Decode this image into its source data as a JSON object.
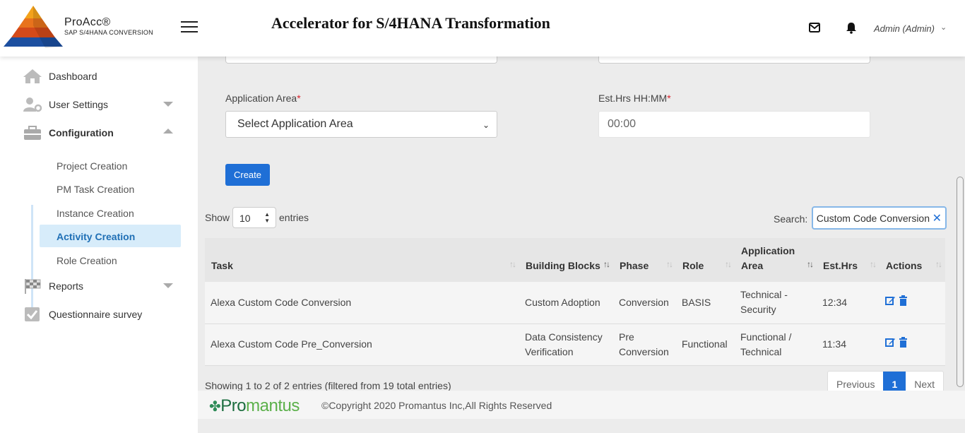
{
  "brand": {
    "title": "ProAcc®",
    "subtitle": "SAP S/4HANA CONVERSION"
  },
  "app_title": "Accelerator for S/4HANA Transformation",
  "user": {
    "name": "Admin (Admin)"
  },
  "sidebar": {
    "items": [
      {
        "label": "Dashboard",
        "icon": "home-icon"
      },
      {
        "label": "User Settings",
        "icon": "user-settings-icon"
      },
      {
        "label": "Configuration",
        "icon": "briefcase-icon"
      },
      {
        "label": "Reports",
        "icon": "flag-icon"
      },
      {
        "label": "Questionnaire survey",
        "icon": "checkbox-icon"
      }
    ],
    "config_sub": [
      {
        "label": "Project Creation"
      },
      {
        "label": "PM Task Creation"
      },
      {
        "label": "Instance Creation"
      },
      {
        "label": "Activity Creation"
      },
      {
        "label": "Role Creation"
      }
    ]
  },
  "form": {
    "app_area_label": "Application Area",
    "app_area_value": "Select Application Area",
    "est_hrs_label": "Est.Hrs HH:MM",
    "est_hrs_value": "00:00",
    "required_mark": "*",
    "create_label": "Create"
  },
  "table_controls": {
    "show_label": "Show",
    "page_length": "10",
    "entries_label": "entries",
    "search_label": "Search:",
    "search_value": "Custom Code Conversion"
  },
  "table": {
    "columns": [
      "Task",
      "Building Blocks",
      "Phase",
      "Role",
      "Application Area",
      "Est.Hrs",
      "Actions"
    ],
    "rows": [
      {
        "task": "Alexa Custom Code Conversion",
        "building_blocks": "Custom Adoption",
        "phase": "Conversion",
        "role": "BASIS",
        "app_area": "Technical - Security",
        "est_hrs": "12:34"
      },
      {
        "task": "Alexa Custom Code Pre_Conversion",
        "building_blocks": "Data Consistency Verification",
        "phase": "Pre Conversion",
        "role": "Functional",
        "app_area": "Functional / Technical",
        "est_hrs": "11:34"
      }
    ]
  },
  "info": "Showing 1 to 2 of 2 entries (filtered from 19 total entries)",
  "pagination": {
    "previous": "Previous",
    "current": "1",
    "next": "Next"
  },
  "footer": {
    "logo_pro": "Pro",
    "logo_mantus": "mantus",
    "copyright": "©Copyright 2020 Promantus Inc,All Rights Reserved"
  },
  "colors": {
    "accent": "#1f6fd6",
    "active_bg": "#d7ecfa",
    "active_text": "#1f6fb5",
    "required": "#d9232d"
  }
}
